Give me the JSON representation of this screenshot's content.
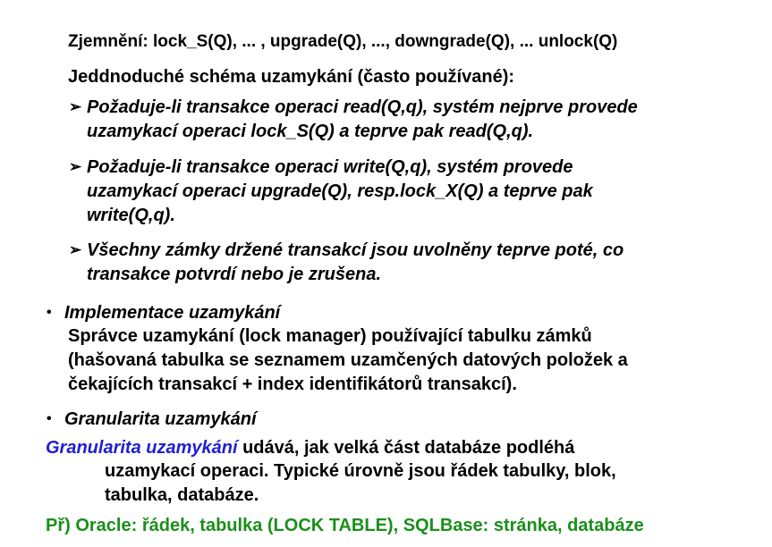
{
  "colors": {
    "text": "#000000",
    "highlight_blue": "#1f1fd6",
    "example_green": "#1a8f1a",
    "background": "#ffffff"
  },
  "weakening": "Zjemnění: lock_S(Q), ... , upgrade(Q), ..., downgrade(Q), ... unlock(Q)",
  "simple_scheme": {
    "heading": "Jeddnoduché schéma uzamykání (často používané):",
    "sub_bullet_glyph": "➢",
    "rules": [
      {
        "lines": [
          "Požaduje-li transakce operaci read(Q,q), systém nejprve provede",
          "uzamykací operaci lock_S(Q) a teprve pak read(Q,q)."
        ]
      },
      {
        "lines": [
          "Požaduje-li transakce operaci write(Q,q), systém provede",
          "uzamykací operaci upgrade(Q), resp.lock_X(Q) a teprve pak",
          "write(Q,q)."
        ]
      },
      {
        "lines": [
          "Všechny zámky držené transakcí jsou uvolněny teprve poté, co",
          "transakce potvrdí nebo je zrušena."
        ]
      }
    ]
  },
  "implementation": {
    "bullet_glyph": "•",
    "heading": "Implementace uzamykání",
    "lines": [
      "Správce uzamykání (lock manager) používající tabulku zámků",
      "(hašovaná tabulka se seznamem uzamčených datových položek a",
      "čekajících transakcí + index identifikátorů transakcí)."
    ]
  },
  "granularity": {
    "bullet_glyph": "•",
    "heading": "Granularita uzamykání",
    "term": "Granularita uzamykání",
    "first_line_rest": " udává, jak velká část databáze podléhá",
    "continuation_lines": [
      "uzamykací operaci. Typické úrovně jsou řádek tabulky, blok,",
      "tabulka, databáze."
    ]
  },
  "example": "Př) Oracle: řádek, tabulka (LOCK TABLE), SQLBase: stránka, databáze"
}
